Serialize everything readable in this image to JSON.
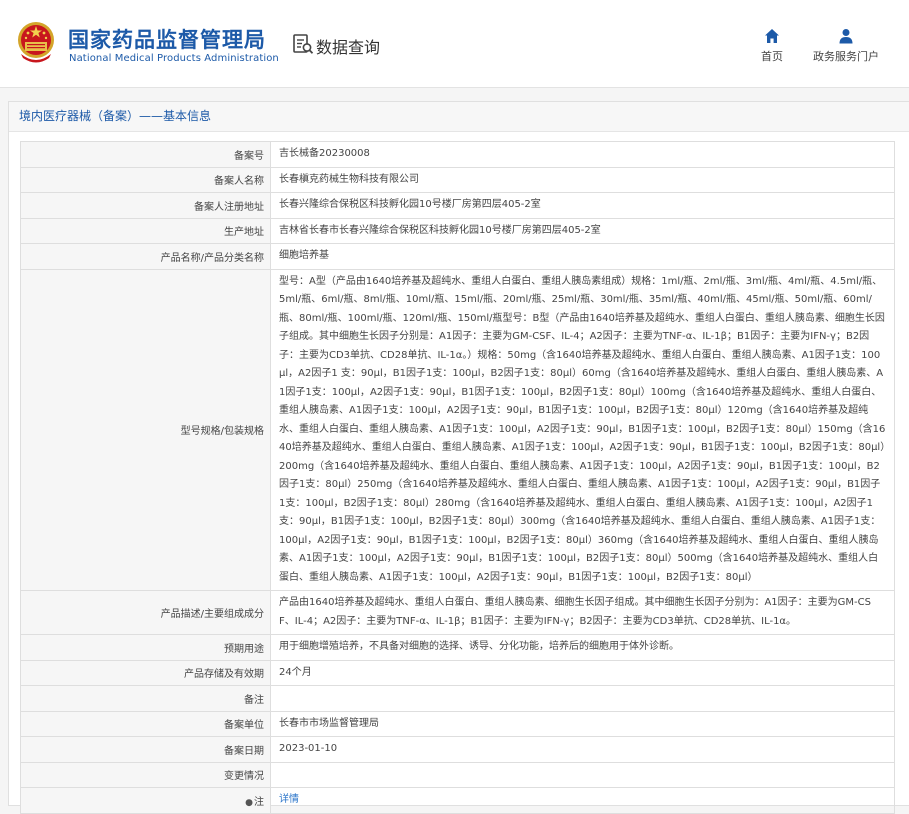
{
  "header": {
    "agency_cn": "国家药品监督管理局",
    "agency_en": "National Medical Products Administration",
    "query_title": "数据查询",
    "nav": [
      {
        "label": "首页",
        "icon": "home-icon"
      },
      {
        "label": "政务服务门户",
        "icon": "user-icon"
      }
    ],
    "brand_color": "#1d5aa8"
  },
  "panel": {
    "title": "境内医疗器械（备案）——基本信息"
  },
  "record": {
    "rows": [
      {
        "label": "备案号",
        "value": "吉长械备20230008"
      },
      {
        "label": "备案人名称",
        "value": "长春槇克药械生物科技有限公司"
      },
      {
        "label": "备案人注册地址",
        "value": "长春兴隆综合保税区科技孵化园10号楼厂房第四层405-2室"
      },
      {
        "label": "生产地址",
        "value": "吉林省长春市长春兴隆综合保税区科技孵化园10号楼厂房第四层405-2室"
      },
      {
        "label": "产品名称/产品分类名称",
        "value": "细胞培养基"
      },
      {
        "label": "型号规格/包装规格",
        "value": "型号：A型（产品由1640培养基及超纯水、重组人白蛋白、重组人胰岛素组成）规格：1ml/瓶、2ml/瓶、3ml/瓶、4ml/瓶、4.5ml/瓶、5ml/瓶、6ml/瓶、8ml/瓶、10ml/瓶、15ml/瓶、20ml/瓶、25ml/瓶、30ml/瓶、35ml/瓶、40ml/瓶、45ml/瓶、50ml/瓶、60ml/瓶、80ml/瓶、100ml/瓶、120ml/瓶、150ml/瓶型号：B型（产品由1640培养基及超纯水、重组人白蛋白、重组人胰岛素、细胞生长因子组成。其中细胞生长因子分别是：A1因子：主要为GM-CSF、IL-4；A2因子：主要为TNF-α、IL-1β；B1因子：主要为IFN-γ；B2因子：主要为CD3单抗、CD28单抗、IL-1α。）规格：50mg（含1640培养基及超纯水、重组人白蛋白、重组人胰岛素、A1因子1支：100μl，A2因子1 支：90μl，B1因子1支：100μl，B2因子1支：80μl）60mg（含1640培养基及超纯水、重组人白蛋白、重组人胰岛素、A1因子1支：100μl，A2因子1支：90μl，B1因子1支：100μl，B2因子1支：80μl）100mg（含1640培养基及超纯水、重组人白蛋白、重组人胰岛素、A1因子1支：100μl，A2因子1支：90μl，B1因子1支：100μl，B2因子1支：80μl）120mg（含1640培养基及超纯水、重组人白蛋白、重组人胰岛素、A1因子1支：100μl，A2因子1支：90μl，B1因子1支：100μl，B2因子1支：80μl）150mg（含1640培养基及超纯水、重组人白蛋白、重组人胰岛素、A1因子1支：100μl，A2因子1支：90μl，B1因子1支：100μl，B2因子1支：80μl）200mg（含1640培养基及超纯水、重组人白蛋白、重组人胰岛素、A1因子1支：100μl，A2因子1支：90μl，B1因子1支：100μl，B2因子1支：80μl）250mg（含1640培养基及超纯水、重组人白蛋白、重组人胰岛素、A1因子1支：100μl，A2因子1支：90μl，B1因子1支：100μl，B2因子1支：80μl）280mg（含1640培养基及超纯水、重组人白蛋白、重组人胰岛素、A1因子1支：100μl，A2因子1支：90μl，B1因子1支：100μl，B2因子1支：80μl）300mg（含1640培养基及超纯水、重组人白蛋白、重组人胰岛素、A1因子1支：100μl，A2因子1支：90μl，B1因子1支：100μl，B2因子1支：80μl）360mg（含1640培养基及超纯水、重组人白蛋白、重组人胰岛素、A1因子1支：100μl，A2因子1支：90μl，B1因子1支：100μl，B2因子1支：80μl）500mg（含1640培养基及超纯水、重组人白蛋白、重组人胰岛素、A1因子1支：100μl，A2因子1支：90μl，B1因子1支：100μl，B2因子1支：80μl）"
      },
      {
        "label": "产品描述/主要组成成分",
        "value": "产品由1640培养基及超纯水、重组人白蛋白、重组人胰岛素、细胞生长因子组成。其中细胞生长因子分别为：A1因子：主要为GM-CSF、IL-4；A2因子：主要为TNF-α、IL-1β；B1因子：主要为IFN-γ；B2因子：主要为CD3单抗、CD28单抗、IL-1α。"
      },
      {
        "label": "预期用途",
        "value": "用于细胞增殖培养，不具备对细胞的选择、诱导、分化功能，培养后的细胞用于体外诊断。"
      },
      {
        "label": "产品存储及有效期",
        "value": "24个月"
      },
      {
        "label": "备注",
        "value": ""
      },
      {
        "label": "备案单位",
        "value": "长春市市场监督管理局"
      },
      {
        "label": "备案日期",
        "value": "2023-01-10"
      },
      {
        "label": "变更情况",
        "value": ""
      }
    ],
    "note_row": {
      "label": "注",
      "link": "详情"
    }
  }
}
